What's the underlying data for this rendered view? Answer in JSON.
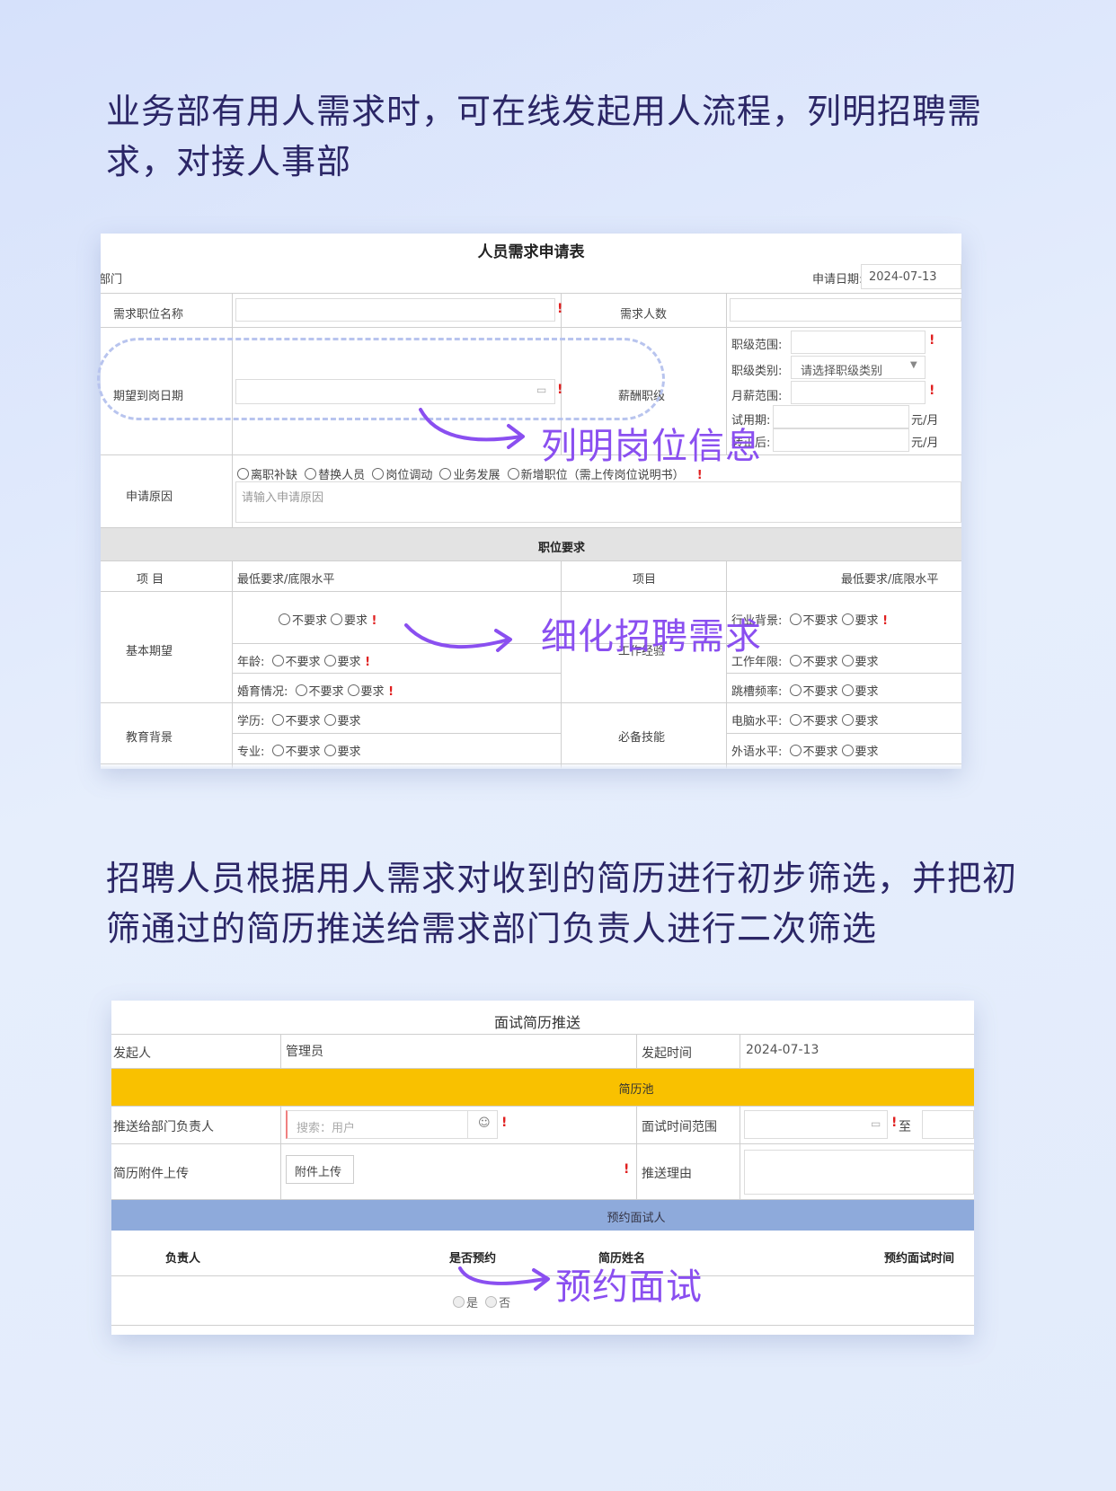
{
  "headline1": "业务部有用人需求时，可在线发起用人流程，列明招聘需求，对接人事部",
  "headline2": "招聘人员根据用人需求对收到的简历进行初步筛选，并把初筛通过的简历推送给需求部门负责人进行二次筛选",
  "form1": {
    "title": "人员需求申请表",
    "dept_label": "部门",
    "apply_date_label": "申请日期:",
    "apply_date_value": "2024-07-13",
    "position_name_label": "需求职位名称",
    "headcount_label": "需求人数",
    "expected_date_label": "期望到岗日期",
    "salary_grade_label": "薪酬职级",
    "grade_range_label": "职级范围:",
    "grade_type_label": "职级类别:",
    "grade_type_placeholder": "请选择职级类别",
    "monthly_salary_label": "月薪范围:",
    "probation_label": "试用期:",
    "after_probation_label": "转正后:",
    "unit_yuan_month": "元/月",
    "reason_label": "申请原因",
    "reason_options": [
      "离职补缺",
      "替换人员",
      "岗位调动",
      "业务发展",
      "新增职位（需上传岗位说明书）"
    ],
    "reason_placeholder": "请输入申请原因",
    "section_requirements": "职位要求",
    "col_item": "项 目",
    "col_min_req": "最低要求/底限水平",
    "col_item2": "项目",
    "col_min_req2": "最低要求/底限水平",
    "basic_expect": "基本期望",
    "age_label": "年龄:",
    "marriage_label": "婚育情况:",
    "edu_background": "教育背景",
    "edu_label": "学历:",
    "major_label": "专业:",
    "work_exp": "工作经验",
    "industry_bg_label": "行业背景:",
    "work_years_label": "工作年限:",
    "job_hop_label": "跳槽频率:",
    "required_skills": "必备技能",
    "computer_label": "电脑水平:",
    "language_label": "外语水平:",
    "opt_not_required": "不要求",
    "opt_required": "要求"
  },
  "form2": {
    "title": "面试简历推送",
    "initiator_label": "发起人",
    "initiator_value": "管理员",
    "time_label": "发起时间",
    "time_value": "2024-07-13",
    "resume_pool": "简历池",
    "push_to_label": "推送给部门负责人",
    "search_placeholder": "搜索：用户",
    "interview_range_label": "面试时间范围",
    "to_label": "至",
    "attach_label": "简历附件上传",
    "attach_button": "附件上传",
    "reason_label": "推送理由",
    "appointment_section": "预约面试人",
    "col_owner": "负责人",
    "col_booked": "是否预约",
    "col_resume_name": "简历姓名",
    "col_interview_time": "预约面试时间",
    "opt_yes": "是",
    "opt_no": "否"
  },
  "annotations": {
    "a1": "列明岗位信息",
    "a2": "细化招聘需求",
    "a3": "预约面试"
  },
  "colors": {
    "accent": "#8a4ff0",
    "headline": "#2b2666",
    "pool_bar": "#f9c100",
    "appointment_bar": "#8eaadb"
  }
}
